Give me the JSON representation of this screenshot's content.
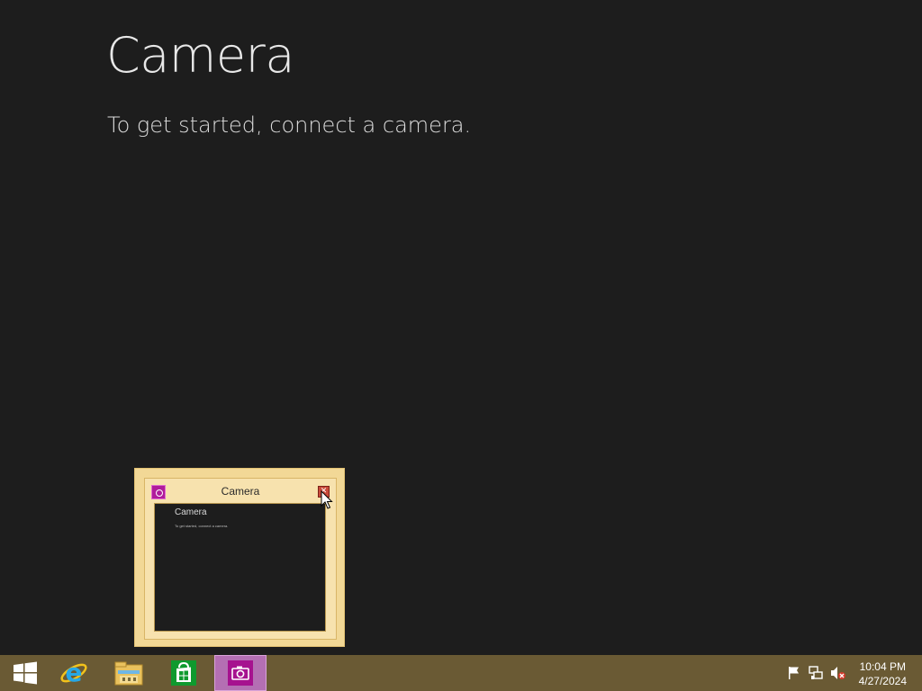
{
  "app": {
    "title": "Camera",
    "message": "To get started, connect a camera."
  },
  "thumbnail": {
    "title": "Camera",
    "icon": "camera-icon",
    "close_icon": "close-icon",
    "preview_title": "Camera",
    "preview_message": "To get started, connect a camera."
  },
  "taskbar": {
    "items": [
      {
        "name": "start-button",
        "icon": "windows-logo-icon"
      },
      {
        "name": "internet-explorer",
        "icon": "internet-explorer-icon"
      },
      {
        "name": "file-explorer",
        "icon": "folder-icon"
      },
      {
        "name": "store",
        "icon": "store-icon"
      },
      {
        "name": "camera",
        "icon": "camera-icon",
        "active": true
      }
    ],
    "tray": {
      "icons": [
        "flag-icon",
        "network-icon",
        "speaker-muted-icon"
      ],
      "time": "10:04 PM",
      "date": "4/27/2024"
    },
    "colors": {
      "taskbar": "#6a5a34",
      "active_item": "#b46fb3",
      "camera_accent": "#b01c9b"
    }
  }
}
